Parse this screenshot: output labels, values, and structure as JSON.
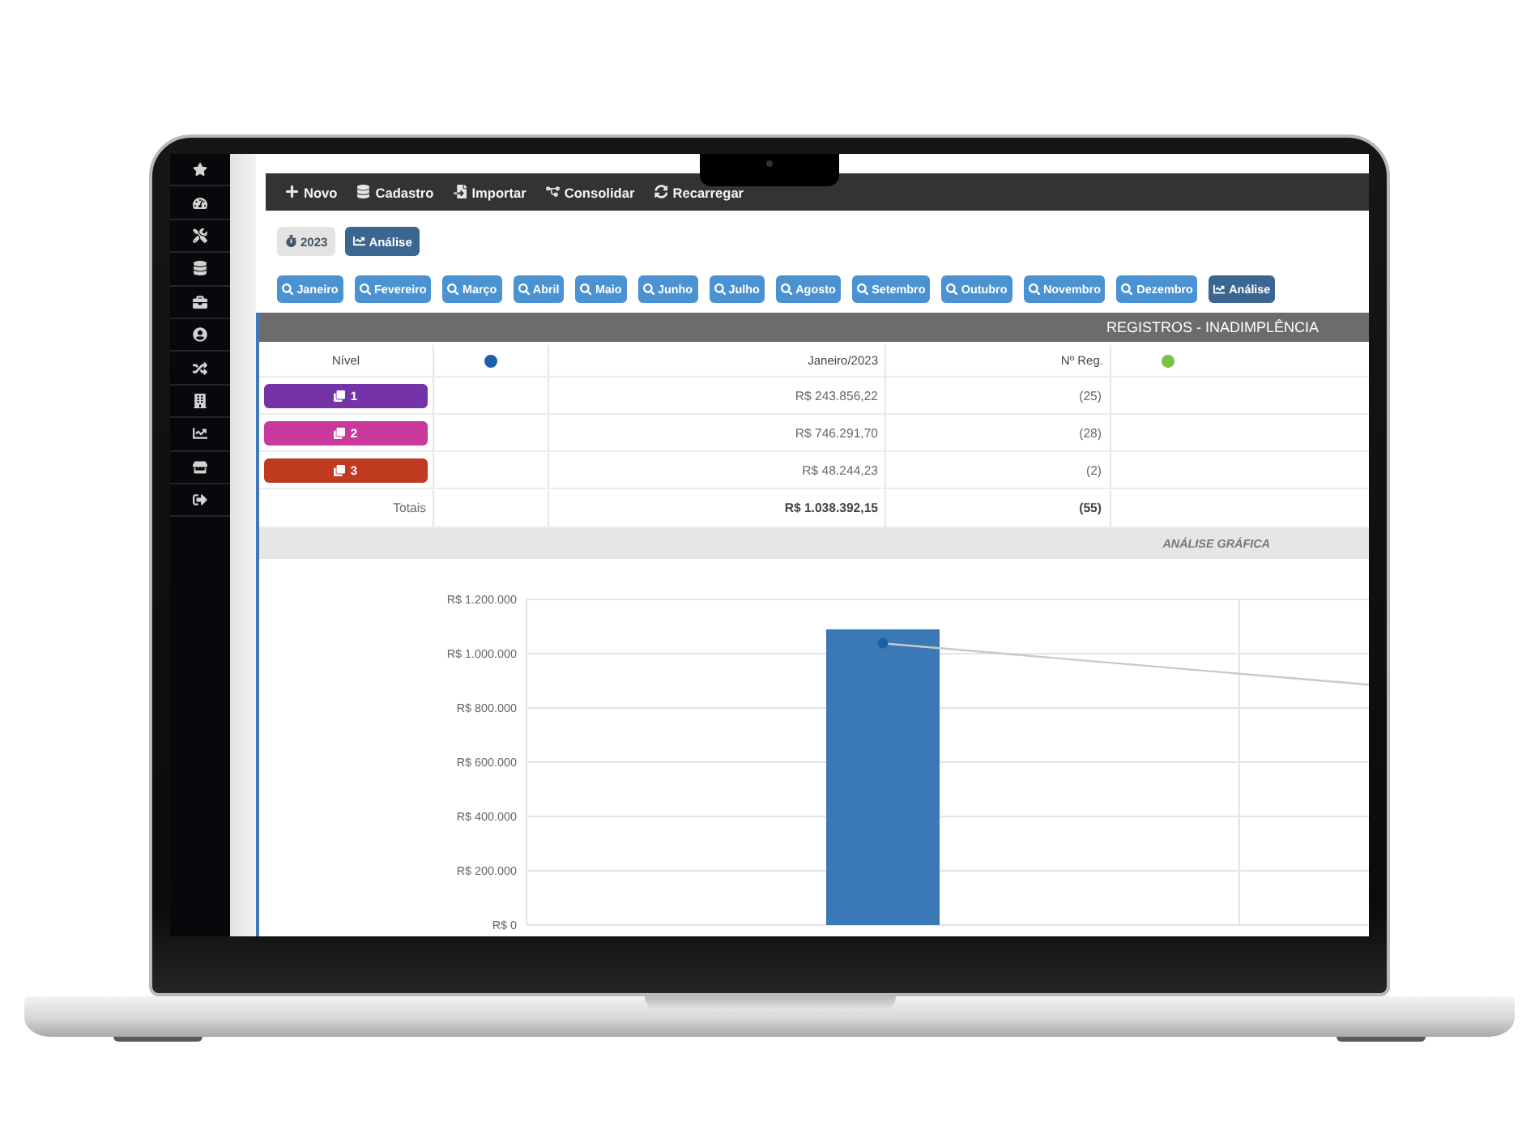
{
  "sidebar": {
    "items": [
      {
        "kind": "star"
      },
      {
        "kind": "gauge"
      },
      {
        "kind": "tools"
      },
      {
        "kind": "database"
      },
      {
        "kind": "briefcase"
      },
      {
        "kind": "user"
      },
      {
        "kind": "shuffle"
      },
      {
        "kind": "building"
      },
      {
        "kind": "chart"
      },
      {
        "kind": "store"
      },
      {
        "kind": "logout"
      }
    ]
  },
  "toolbar": {
    "buttons": [
      {
        "label": "Novo"
      },
      {
        "label": "Cadastro"
      },
      {
        "label": "Importar"
      },
      {
        "label": "Consolidar"
      },
      {
        "label": "Recarregar"
      }
    ]
  },
  "filters": [
    {
      "kind": "year",
      "label": "2023"
    },
    {
      "kind": "analysis",
      "label": "Análise"
    }
  ],
  "months": [
    {
      "kind": "month",
      "label": "Janeiro"
    },
    {
      "kind": "month",
      "label": "Fevereiro"
    },
    {
      "kind": "month",
      "label": "Março"
    },
    {
      "kind": "month",
      "label": "Abril"
    },
    {
      "kind": "month",
      "label": "Maio"
    },
    {
      "kind": "month",
      "label": "Junho"
    },
    {
      "kind": "month",
      "label": "Julho"
    },
    {
      "kind": "month",
      "label": "Agosto"
    },
    {
      "kind": "month",
      "label": "Setembro"
    },
    {
      "kind": "month",
      "label": "Outubro"
    },
    {
      "kind": "month",
      "label": "Novembro"
    },
    {
      "kind": "month",
      "label": "Dezembro"
    },
    {
      "kind": "analysis",
      "label": "Análise"
    }
  ],
  "panel": {
    "title": "REGISTROS - INADIMPLÊNCIA",
    "table": {
      "columns": [
        {
          "kind": "text",
          "label": "Nível"
        },
        {
          "kind": "dot",
          "color": "#1b5faa"
        },
        {
          "kind": "text",
          "label": "Janeiro/2023"
        },
        {
          "kind": "text",
          "label": "Nº Reg."
        },
        {
          "kind": "dot",
          "color": "#7bc143"
        }
      ],
      "rows": [
        {
          "badge": "1",
          "color": "#7433a6",
          "amount": "R$ 243.856,22",
          "count": "(25)"
        },
        {
          "badge": "2",
          "color": "#c9399c",
          "amount": "R$ 746.291,70",
          "count": "(28)"
        },
        {
          "badge": "3",
          "color": "#bf3a1f",
          "amount": "R$ 48.244,23",
          "count": "(2)"
        }
      ],
      "totals": {
        "label": "Totais",
        "amount": "R$ 1.038.392,15",
        "count": "(55)"
      }
    },
    "section_title": "ANÁLISE GRÁFICA",
    "chart": {
      "axis_labels": [
        "R$ 1.200.000",
        "R$ 1.000.000",
        "R$ 800.000",
        "R$ 600.000",
        "R$ 400.000",
        "R$ 200.000",
        "R$ 0"
      ]
    }
  }
}
